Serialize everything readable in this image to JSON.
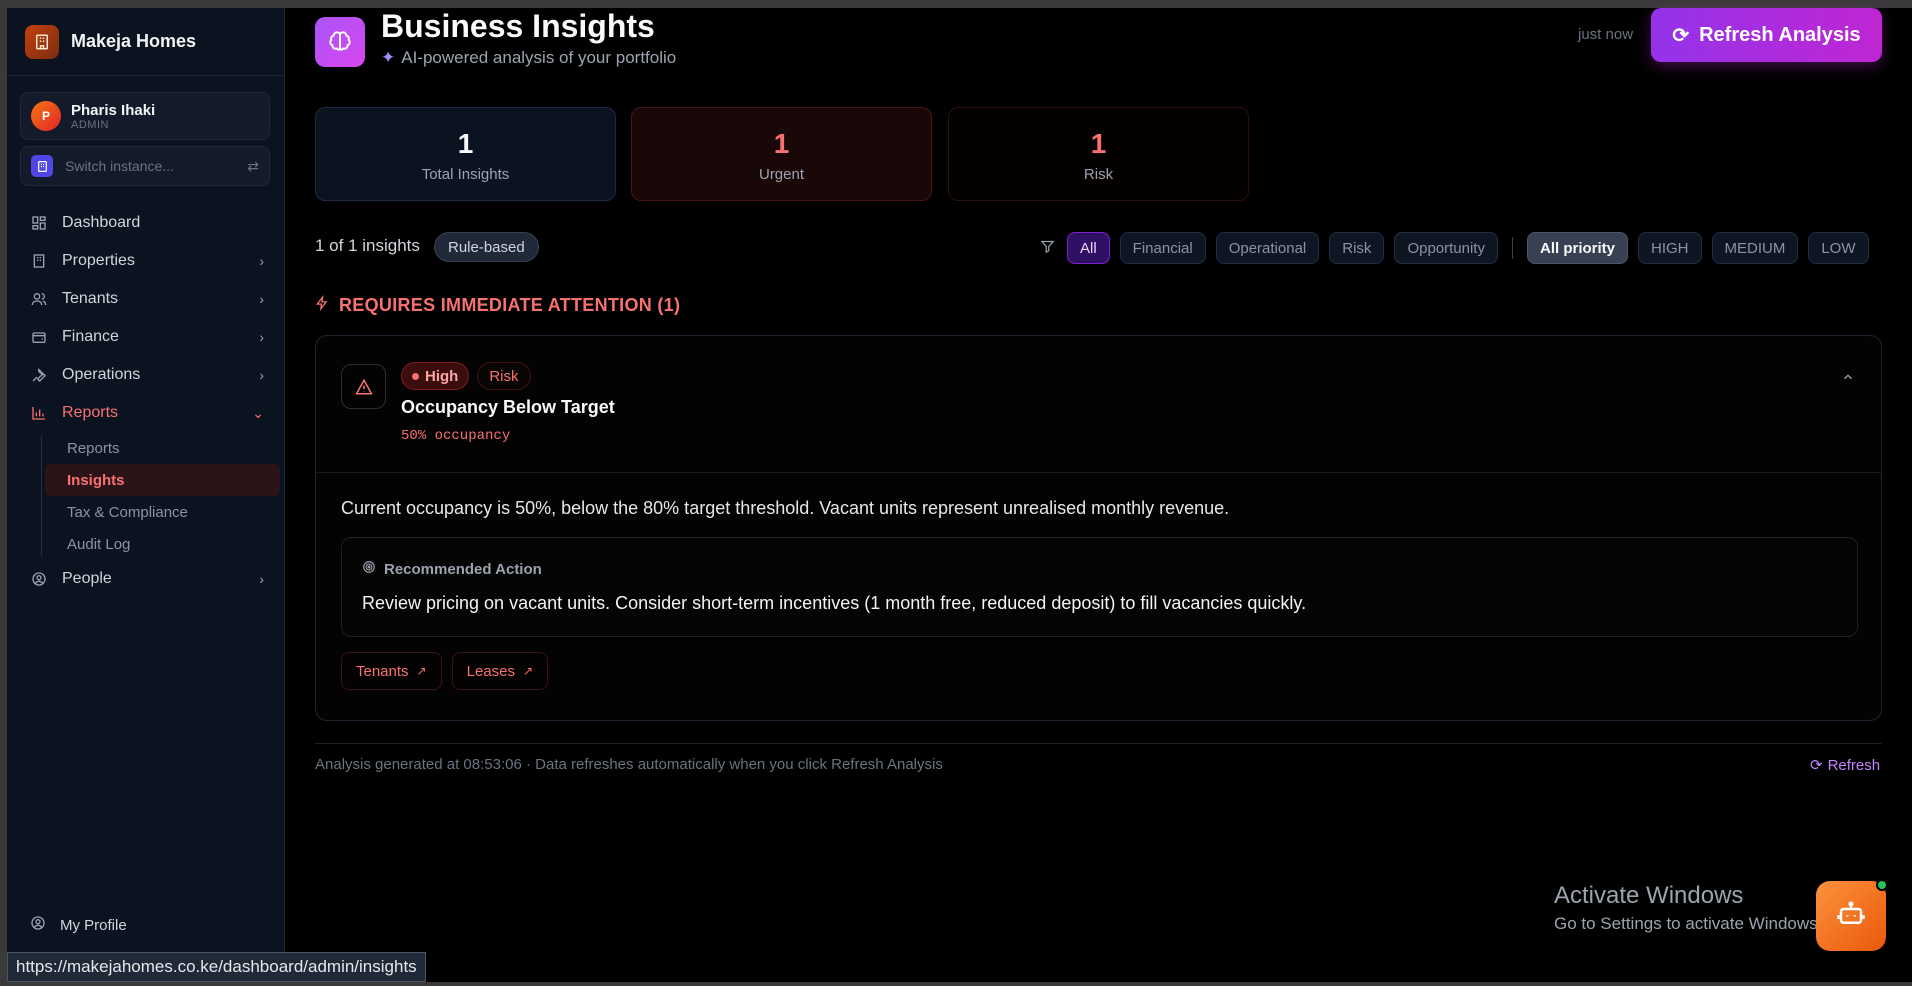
{
  "app": {
    "name": "Makeja Homes"
  },
  "user": {
    "initial": "P",
    "name": "Pharis Ihaki",
    "role": "ADMIN"
  },
  "switcher": {
    "placeholder": "Switch instance..."
  },
  "nav": {
    "items": [
      {
        "label": "Dashboard",
        "icon": "grid-icon"
      },
      {
        "label": "Properties",
        "icon": "building-icon"
      },
      {
        "label": "Tenants",
        "icon": "users-icon"
      },
      {
        "label": "Finance",
        "icon": "wallet-icon"
      },
      {
        "label": "Operations",
        "icon": "wrench-icon"
      },
      {
        "label": "Reports",
        "icon": "bar-chart-icon"
      },
      {
        "label": "People",
        "icon": "user-circle-icon"
      }
    ],
    "reports_sub": [
      {
        "label": "Reports"
      },
      {
        "label": "Insights"
      },
      {
        "label": "Tax & Compliance"
      },
      {
        "label": "Audit Log"
      }
    ],
    "profile": "My Profile"
  },
  "status_url": "https://makejahomes.co.ke/dashboard/admin/insights",
  "header": {
    "title": "Business Insights",
    "subtitle": "AI-powered analysis of your portfolio",
    "updated": "just now",
    "refresh_label": "Refresh Analysis"
  },
  "stats": [
    {
      "value": "1",
      "label": "Total Insights"
    },
    {
      "value": "1",
      "label": "Urgent"
    },
    {
      "value": "1",
      "label": "Risk"
    }
  ],
  "toolbar": {
    "count": "1 of 1 insights",
    "mode_badge": "Rule-based",
    "category_filters": [
      "All",
      "Financial",
      "Operational",
      "Risk",
      "Opportunity"
    ],
    "priority_filters": [
      "All priority",
      "HIGH",
      "MEDIUM",
      "LOW"
    ]
  },
  "section": {
    "title": "REQUIRES IMMEDIATE ATTENTION (1)"
  },
  "insight": {
    "priority": "High",
    "category": "Risk",
    "title": "Occupancy Below Target",
    "metric": "50% occupancy",
    "description": "Current occupancy is 50%, below the 80% target threshold. Vacant units represent unrealised monthly revenue.",
    "recommendation_heading": "Recommended Action",
    "recommendation": "Review pricing on vacant units. Consider short-term incentives (1 month free, reduced deposit) to fill vacancies quickly.",
    "links": [
      "Tenants",
      "Leases"
    ]
  },
  "footer": {
    "text": "Analysis generated at 08:53:06 · Data refreshes automatically when you click Refresh Analysis",
    "refresh": "Refresh"
  },
  "watermark": {
    "line1": "Activate Windows",
    "line2": "Go to Settings to activate Windows."
  },
  "colors": {
    "accent": "#c026d3",
    "danger": "#f87171",
    "bg": "#000000",
    "sidebar": "#0b1220"
  }
}
